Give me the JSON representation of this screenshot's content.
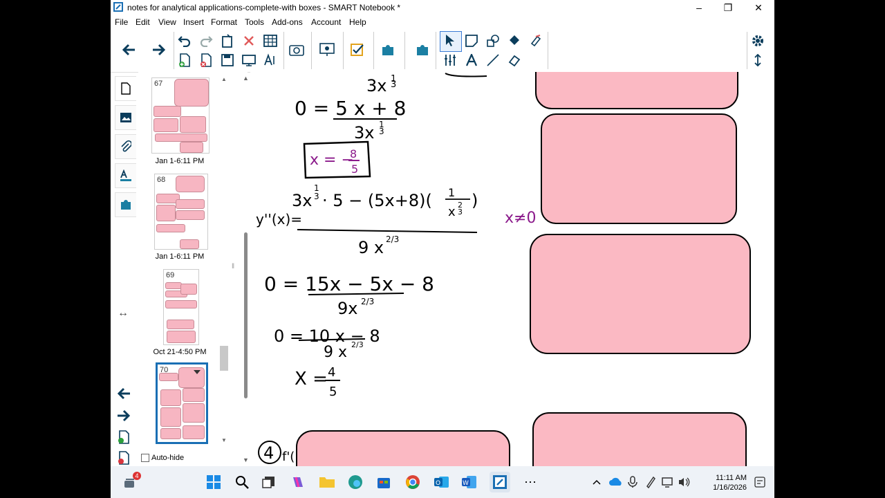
{
  "window": {
    "title": "notes for analytical applications-complete-with boxes - SMART Notebook *",
    "controls": [
      "minimize",
      "maximize",
      "close"
    ]
  },
  "menu": {
    "items": [
      "File",
      "Edit",
      "View",
      "Insert",
      "Format",
      "Tools",
      "Add-ons",
      "Account",
      "Help"
    ]
  },
  "toolbar": {
    "icons": [
      "back-icon",
      "forward-icon",
      "undo-icon",
      "redo-icon",
      "paste-icon",
      "delete-icon",
      "table-icon",
      "add-page-icon",
      "delete-page-icon",
      "save-icon",
      "screen-shade-icon",
      "text-recognition-icon",
      "camera-icon",
      "document-camera-icon",
      "activity-icon",
      "addon-puzzle-icon",
      "select-icon",
      "pen-icon",
      "shapes-icon",
      "fill-icon",
      "eraser-icon",
      "table-tool-icon",
      "text-tool-icon",
      "line-tool-icon",
      "eraser2-icon",
      "settings-icon",
      "move-toolbar-icon"
    ],
    "active_tool": "select-icon"
  },
  "sidetabs": [
    "page-sorter-icon",
    "gallery-icon",
    "attachments-icon",
    "properties-icon",
    "addons-icon"
  ],
  "thumbnails": [
    {
      "number": "67",
      "date": "Jan 1-6:11 PM"
    },
    {
      "number": "68",
      "date": "Jan 1-6:11 PM"
    },
    {
      "number": "69",
      "date": "Oct 21-4:50 PM"
    },
    {
      "number": "70",
      "date": ""
    }
  ],
  "autohide_label": "Auto-hide",
  "canvas": {
    "handwriting": {
      "line1": "3x^(1/3)",
      "line2": "0 = 5x+8 / 3x^(1/3)",
      "boxed_answer": "x = -8/5",
      "second_derivative": "y''(x) = 3x^(1/3)·5 − (5x+8)(1/x^(2/3)) / 9x^(2/3)",
      "condition": "x≠0",
      "step1": "0 = 15x − 5x − 8 / 9x^(2/3)",
      "step2": "0 = 10x − 8 / 9x^(2/3)",
      "result": "x = 4/5",
      "item4": "(4) f'("
    },
    "box_color": "#fbb9c3"
  },
  "taskbar": {
    "notification_count": "4",
    "time": "11:11 AM",
    "date": "1/16/2026"
  }
}
